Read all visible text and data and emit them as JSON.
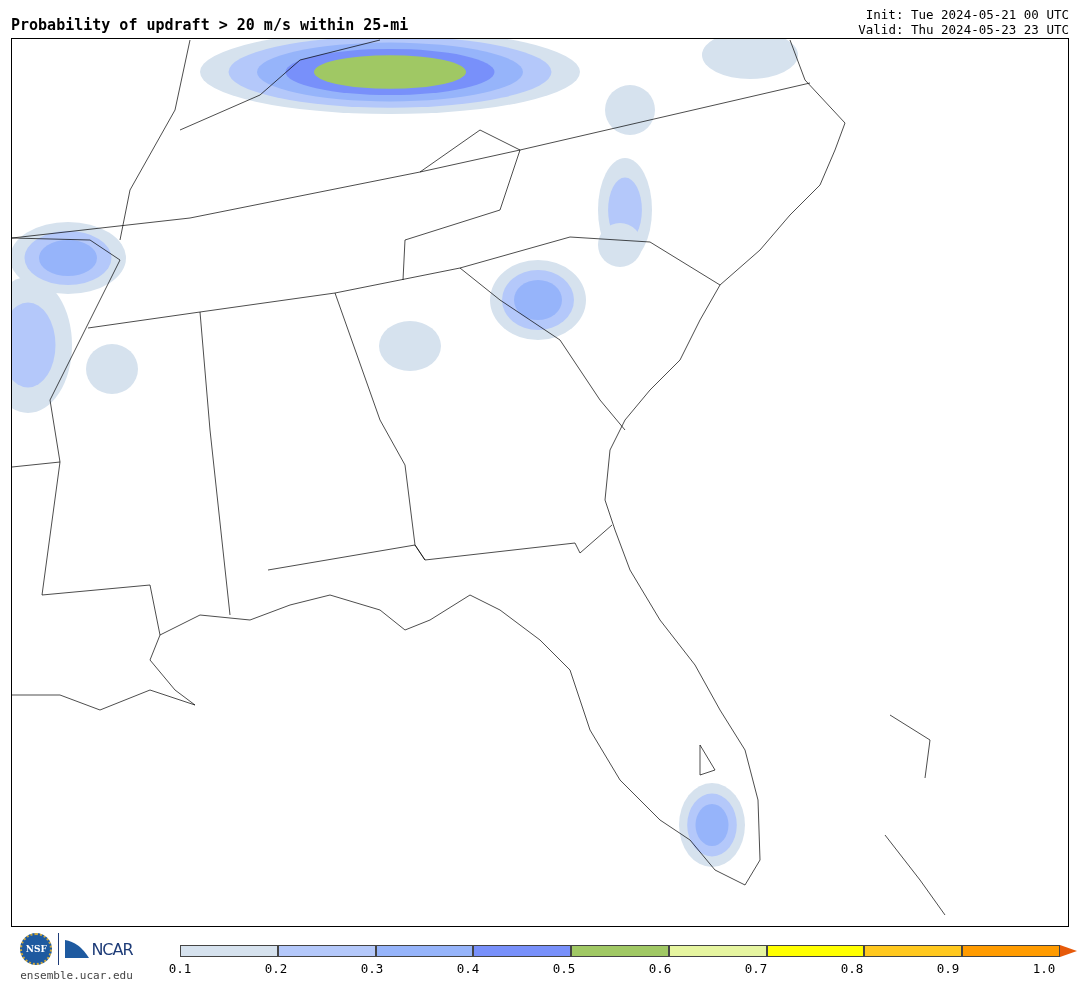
{
  "title": "Probability of updraft > 20 m/s within 25-mi",
  "init": "Init: Tue 2024-05-21 00 UTC",
  "valid": "Valid: Thu 2024-05-23 23 UTC",
  "logos": {
    "nsf": "NSF",
    "ncar": "NCAR",
    "url": "ensemble.ucar.edu"
  },
  "colorbar": {
    "bins": [
      {
        "color": "#d6e2ee"
      },
      {
        "color": "#b4c8fa"
      },
      {
        "color": "#96b4fa"
      },
      {
        "color": "#7890fa"
      },
      {
        "color": "#a0c864"
      },
      {
        "color": "#e6f5a0"
      },
      {
        "color": "#ffff00"
      },
      {
        "color": "#ffc81e"
      },
      {
        "color": "#ff9b00"
      }
    ],
    "extend_arrow": {
      "color": "#e65a0a"
    },
    "ticks": [
      "0.1",
      "0.2",
      "0.3",
      "0.4",
      "0.5",
      "0.6",
      "0.7",
      "0.8",
      "0.9",
      "1.0"
    ]
  }
}
